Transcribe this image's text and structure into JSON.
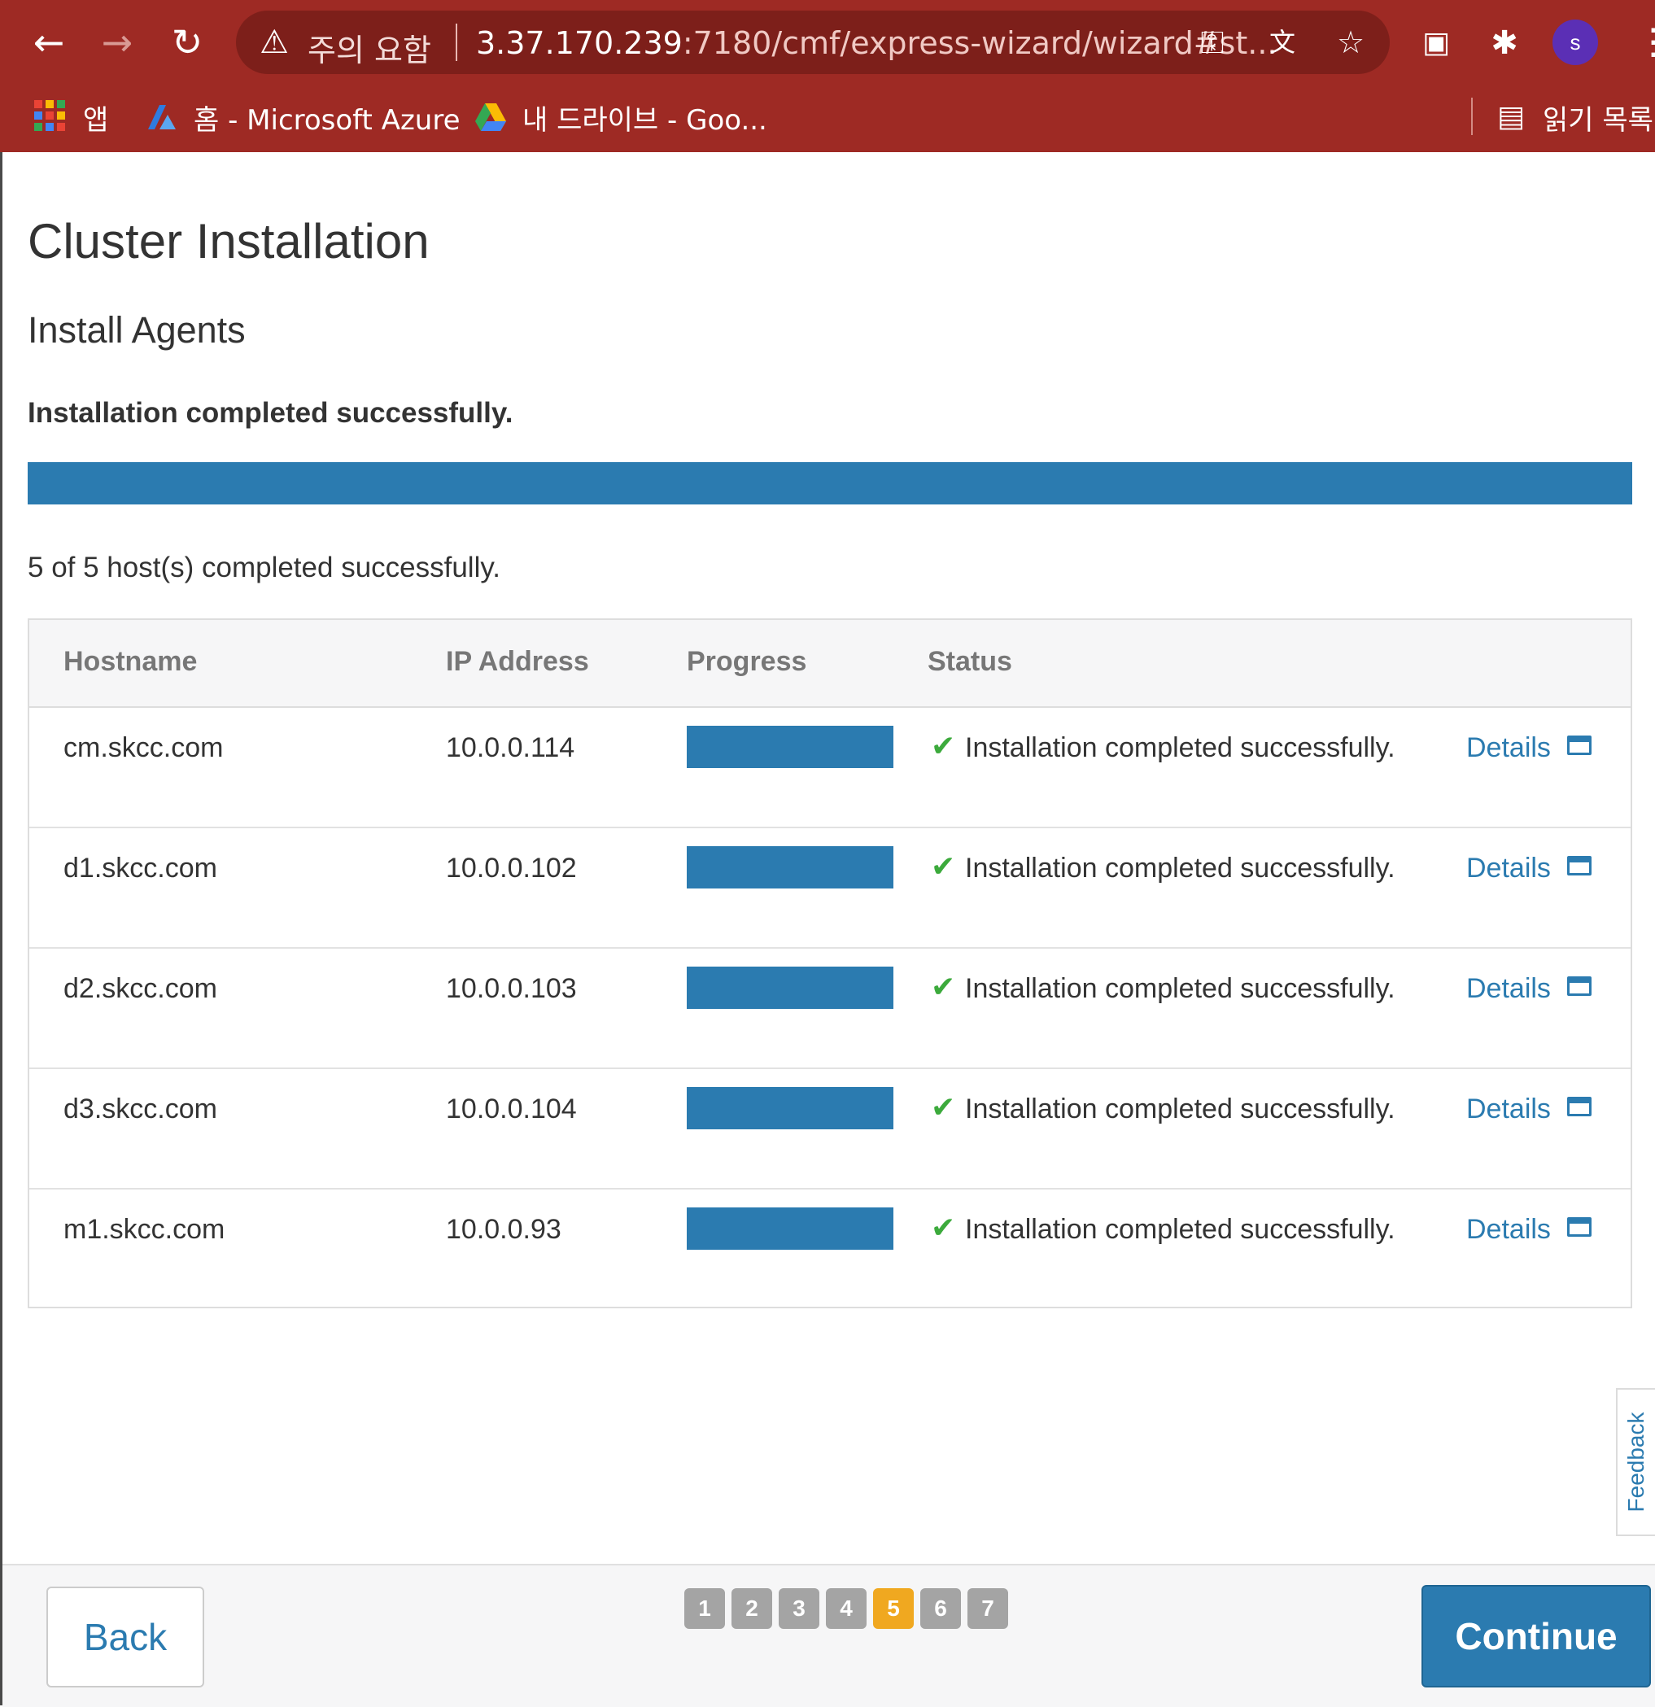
{
  "browser": {
    "security_label": "주의 요함",
    "url_host": "3.37.170.239",
    "url_rest": ":7180/cmf/express-wizard/wizard#st...",
    "profile_initial": "s",
    "bookmarks": {
      "apps": "앱",
      "azure": "홈 - Microsoft Azure",
      "drive": "내 드라이브 - Goo...",
      "reading_list": "읽기 목록"
    }
  },
  "page": {
    "title": "Cluster Installation",
    "subtitle": "Install Agents",
    "status_message": "Installation completed successfully.",
    "overall_progress_fraction": 1.0,
    "hosts_summary": "5 of 5 host(s) completed successfully."
  },
  "table": {
    "headers": {
      "hostname": "Hostname",
      "ip": "IP Address",
      "progress": "Progress",
      "status": "Status"
    },
    "rows": [
      {
        "hostname": "cm.skcc.com",
        "ip": "10.0.0.114",
        "progress": 1.0,
        "status": "Installation completed successfully.",
        "details": "Details"
      },
      {
        "hostname": "d1.skcc.com",
        "ip": "10.0.0.102",
        "progress": 1.0,
        "status": "Installation completed successfully.",
        "details": "Details"
      },
      {
        "hostname": "d2.skcc.com",
        "ip": "10.0.0.103",
        "progress": 1.0,
        "status": "Installation completed successfully.",
        "details": "Details"
      },
      {
        "hostname": "d3.skcc.com",
        "ip": "10.0.0.104",
        "progress": 1.0,
        "status": "Installation completed successfully.",
        "details": "Details"
      },
      {
        "hostname": "m1.skcc.com",
        "ip": "10.0.0.93",
        "progress": 1.0,
        "status": "Installation completed successfully.",
        "details": "Details"
      }
    ]
  },
  "feedback_label": "Feedback",
  "footer": {
    "back_label": "Back",
    "continue_label": "Continue",
    "steps": [
      "1",
      "2",
      "3",
      "4",
      "5",
      "6",
      "7"
    ],
    "active_step": "5"
  },
  "colors": {
    "chrome": "#9e2a24",
    "accent": "#2b7bb0",
    "success": "#3caa3c",
    "active_step": "#f0a820"
  },
  "icons": [
    "back-arrow-icon",
    "forward-arrow-icon",
    "reload-icon",
    "warning-icon",
    "key-icon",
    "translate-icon",
    "star-icon",
    "cast-icon",
    "extensions-icon",
    "menu-icon",
    "apps-grid-icon",
    "azure-icon",
    "drive-icon",
    "reading-list-icon",
    "check-icon",
    "window-icon"
  ]
}
